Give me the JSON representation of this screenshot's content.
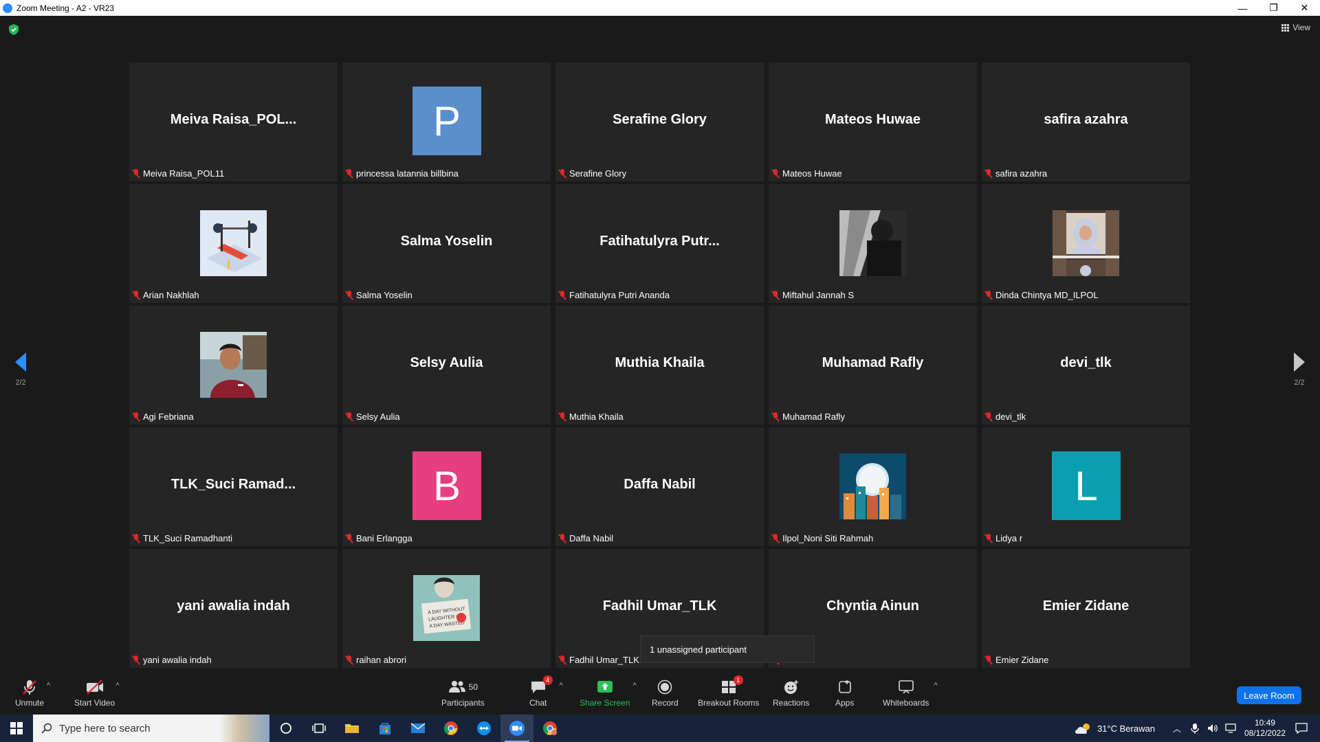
{
  "window": {
    "title": "Zoom Meeting - A2 - VR23",
    "minimize": "—",
    "maximize": "❐",
    "close": "✕"
  },
  "header": {
    "view_label": "View"
  },
  "pagination": {
    "left": "2/2",
    "right": "2/2"
  },
  "colors": {
    "accent": "#2d8cff",
    "leave": "#0e72ed",
    "share_green": "#25c258",
    "muted_red": "#e02828"
  },
  "tiles": [
    {
      "big": "Meiva  Raisa_POL...",
      "name": "Meiva Raisa_POL11"
    },
    {
      "avatar": "P",
      "color": "#5b8ecc",
      "name": "princessa latannia billbina"
    },
    {
      "big": "Serafine Glory",
      "name": "Serafine Glory"
    },
    {
      "big": "Mateos Huwae",
      "name": "Mateos Huwae"
    },
    {
      "big": "safira azahra",
      "name": "safira azahra"
    },
    {
      "photo": "gym-equipment",
      "name": "Arian Nakhlah"
    },
    {
      "big": "Salma Yoselin",
      "name": "Salma Yoselin"
    },
    {
      "big": "Fatihatulyra  Putr...",
      "name": "Fatihatulyra Putri Ananda"
    },
    {
      "photo": "dark-bw",
      "name": "Miftahul Jannah S"
    },
    {
      "photo": "hijab-video",
      "name": "Dinda Chintya MD_ILPOL"
    },
    {
      "photo": "boy-red-shirt",
      "name": "Agi Febriana"
    },
    {
      "big": "Selsy Aulia",
      "name": "Selsy Aulia"
    },
    {
      "big": "Muthia Khaila",
      "name": "Muthia Khaila"
    },
    {
      "big": "Muhamad Rafly",
      "name": "Muhamad Rafly"
    },
    {
      "big": "devi_tlk",
      "name": "devi_tlk"
    },
    {
      "big": "TLK_Suci  Ramad...",
      "name": "TLK_Suci Ramadhanti"
    },
    {
      "avatar": "B",
      "color": "#e63e7e",
      "name": "Bani Erlangga"
    },
    {
      "big": "Daffa Nabil",
      "name": "Daffa Nabil"
    },
    {
      "photo": "moon-city",
      "name": "Ilpol_Noni Siti Rahmah"
    },
    {
      "avatar": "L",
      "color": "#0b9eb0",
      "name": "Lidya r"
    },
    {
      "big": "yani awalia indah",
      "name": "yani awalia indah"
    },
    {
      "photo": "girl-sign",
      "name": "raihan abrori"
    },
    {
      "big": "Fadhil Umar_TLK",
      "name": "Fadhil Umar_TLK"
    },
    {
      "big": "Chyntia Ainun",
      "name": "Ainun"
    },
    {
      "big": "Emier Zidane",
      "name": "Emier Zidane"
    }
  ],
  "tooltip": {
    "text": "1 unassigned participant"
  },
  "toolbar": {
    "unmute": "Unmute",
    "start_video": "Start Video",
    "participants": "Participants",
    "participants_count": "50",
    "chat": "Chat",
    "chat_badge": "4",
    "share_screen": "Share Screen",
    "record": "Record",
    "breakout": "Breakout Rooms",
    "breakout_badge": "1",
    "reactions": "Reactions",
    "apps": "Apps",
    "whiteboards": "Whiteboards",
    "leave": "Leave Room"
  },
  "taskbar": {
    "search_placeholder": "Type here to search",
    "weather": "31°C  Berawan",
    "time": "10:49",
    "date": "08/12/2022"
  }
}
